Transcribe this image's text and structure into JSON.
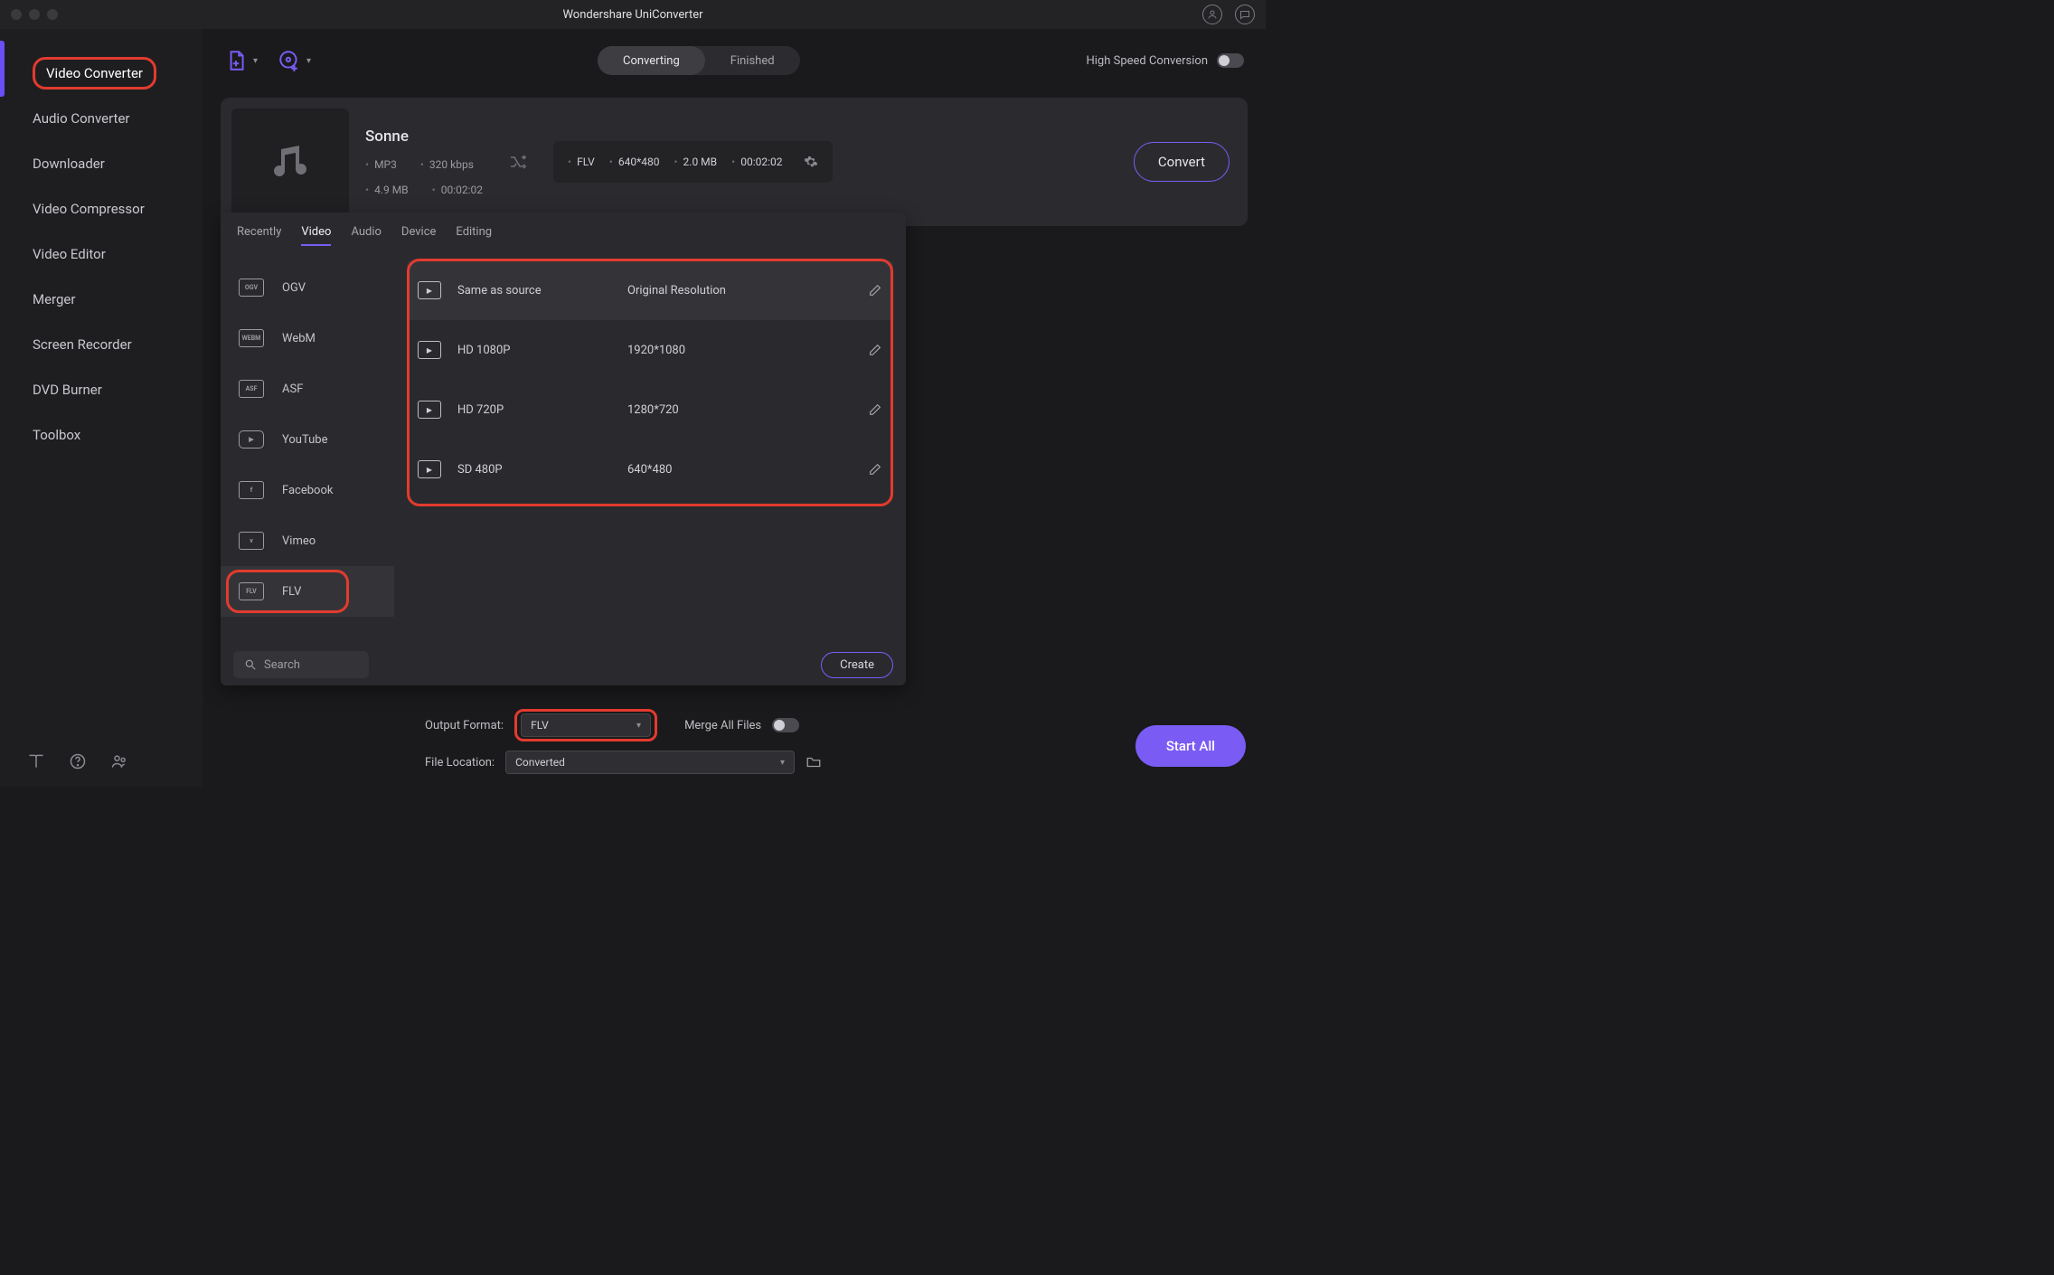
{
  "title": "Wondershare UniConverter",
  "sidebar": {
    "items": [
      {
        "label": "Video Converter"
      },
      {
        "label": "Audio Converter"
      },
      {
        "label": "Downloader"
      },
      {
        "label": "Video Compressor"
      },
      {
        "label": "Video Editor"
      },
      {
        "label": "Merger"
      },
      {
        "label": "Screen Recorder"
      },
      {
        "label": "DVD Burner"
      },
      {
        "label": "Toolbox"
      }
    ]
  },
  "toolbar": {
    "seg": {
      "converting": "Converting",
      "finished": "Finished"
    },
    "hs_label": "High Speed Conversion"
  },
  "file": {
    "name": "Sonne",
    "src": {
      "codec": "MP3",
      "bitrate": "320 kbps",
      "size": "4.9 MB",
      "duration": "00:02:02"
    },
    "dst": {
      "format": "FLV",
      "res": "640*480",
      "size": "2.0 MB",
      "duration": "00:02:02"
    },
    "convert_label": "Convert"
  },
  "popup": {
    "tabs": {
      "recently": "Recently",
      "video": "Video",
      "audio": "Audio",
      "device": "Device",
      "editing": "Editing"
    },
    "formats": [
      {
        "label": "OGV",
        "icon": "OGV"
      },
      {
        "label": "WebM",
        "icon": "WEBM"
      },
      {
        "label": "ASF",
        "icon": "ASF"
      },
      {
        "label": "YouTube",
        "icon": "▶"
      },
      {
        "label": "Facebook",
        "icon": "f"
      },
      {
        "label": "Vimeo",
        "icon": "v"
      },
      {
        "label": "FLV",
        "icon": "FLV"
      }
    ],
    "resolutions": [
      {
        "name": "Same as source",
        "dim": "Original Resolution"
      },
      {
        "name": "HD 1080P",
        "dim": "1920*1080"
      },
      {
        "name": "HD 720P",
        "dim": "1280*720"
      },
      {
        "name": "SD 480P",
        "dim": "640*480"
      }
    ],
    "search_placeholder": "Search",
    "create_label": "Create"
  },
  "bottom": {
    "output_label": "Output Format:",
    "output_value": "FLV",
    "merge_label": "Merge All Files",
    "loc_label": "File Location:",
    "loc_value": "Converted",
    "start_all": "Start All"
  }
}
